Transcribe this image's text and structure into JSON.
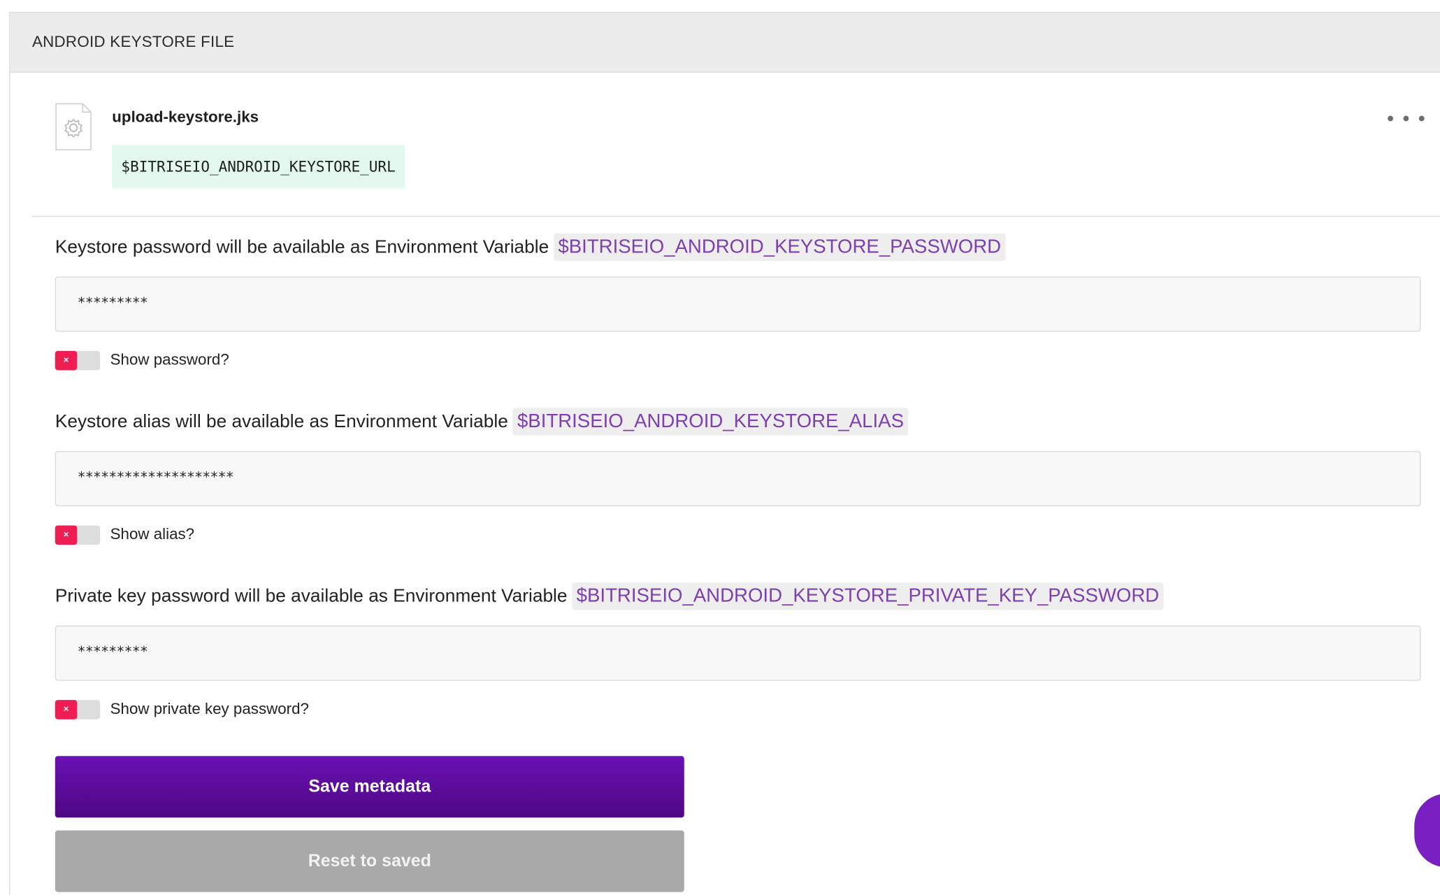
{
  "panel": {
    "title": "ANDROID KEYSTORE FILE"
  },
  "file": {
    "icon": "file-gear-icon",
    "name": "upload-keystore.jks",
    "env_var": "$BITRISEIO_ANDROID_KEYSTORE_URL",
    "more_icon": "more-horizontal-icon"
  },
  "fields": {
    "password": {
      "label": "Keystore password will be available as Environment Variable",
      "env_var": "$BITRISEIO_ANDROID_KEYSTORE_PASSWORD",
      "value": "*********",
      "toggle_label": "Show password?",
      "toggle_on": false
    },
    "alias": {
      "label": "Keystore alias will be available as Environment Variable",
      "env_var": "$BITRISEIO_ANDROID_KEYSTORE_ALIAS",
      "value": "********************",
      "toggle_label": "Show alias?",
      "toggle_on": false
    },
    "private_key_password": {
      "label": "Private key password will be available as Environment Variable",
      "env_var": "$BITRISEIO_ANDROID_KEYSTORE_PRIVATE_KEY_PASSWORD",
      "value": "*********",
      "toggle_label": "Show private key password?",
      "toggle_on": false
    }
  },
  "toggle_off_glyph": "×",
  "buttons": {
    "save_label": "Save metadata",
    "reset_label": "Reset to saved"
  },
  "colors": {
    "save_button": "#5f0ea0",
    "reset_button": "#a9a9a9",
    "env_pill_text": "#7e3fb0",
    "toggle_off": "#ee1e52",
    "file_env_bg": "#e3f8ef"
  },
  "chat_widget": {
    "icon": "chat-icon"
  }
}
